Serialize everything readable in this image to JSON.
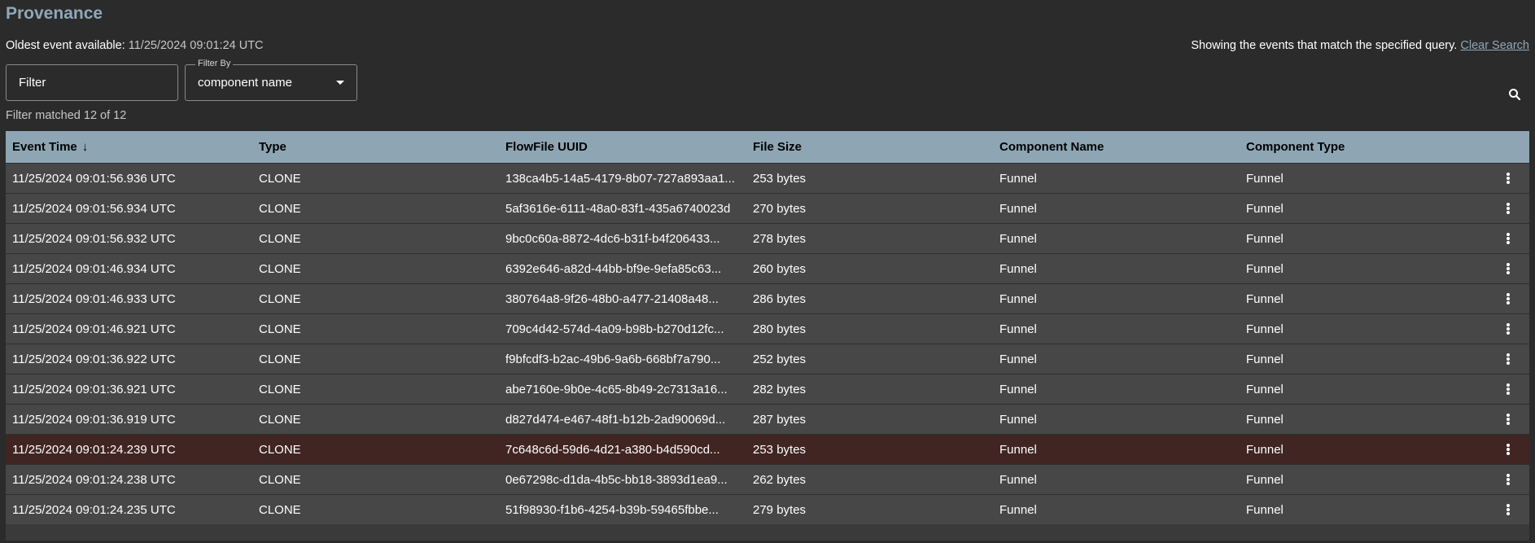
{
  "page_title": "Provenance",
  "oldest": {
    "label": "Oldest event available:",
    "value": "11/25/2024 09:01:24 UTC"
  },
  "query_status": {
    "text": "Showing the events that match the specified query.",
    "clear_label": "Clear Search"
  },
  "filter": {
    "placeholder": "Filter",
    "filter_by_label": "Filter By",
    "filter_by_value": "component name"
  },
  "matched_text": "Filter matched 12 of 12",
  "table": {
    "headers": [
      "Event Time",
      "Type",
      "FlowFile UUID",
      "File Size",
      "Component Name",
      "Component Type"
    ],
    "sort_indicator": "↓",
    "rows": [
      {
        "time": "11/25/2024 09:01:56.936 UTC",
        "type": "CLONE",
        "uuid": "138ca4b5-14a5-4179-8b07-727a893aa1...",
        "size": "253 bytes",
        "name": "Funnel",
        "ctype": "Funnel"
      },
      {
        "time": "11/25/2024 09:01:56.934 UTC",
        "type": "CLONE",
        "uuid": "5af3616e-6111-48a0-83f1-435a6740023d",
        "size": "270 bytes",
        "name": "Funnel",
        "ctype": "Funnel"
      },
      {
        "time": "11/25/2024 09:01:56.932 UTC",
        "type": "CLONE",
        "uuid": "9bc0c60a-8872-4dc6-b31f-b4f206433...",
        "size": "278 bytes",
        "name": "Funnel",
        "ctype": "Funnel"
      },
      {
        "time": "11/25/2024 09:01:46.934 UTC",
        "type": "CLONE",
        "uuid": "6392e646-a82d-44bb-bf9e-9efa85c63...",
        "size": "260 bytes",
        "name": "Funnel",
        "ctype": "Funnel"
      },
      {
        "time": "11/25/2024 09:01:46.933 UTC",
        "type": "CLONE",
        "uuid": "380764a8-9f26-48b0-a477-21408a48...",
        "size": "286 bytes",
        "name": "Funnel",
        "ctype": "Funnel"
      },
      {
        "time": "11/25/2024 09:01:46.921 UTC",
        "type": "CLONE",
        "uuid": "709c4d42-574d-4a09-b98b-b270d12fc...",
        "size": "280 bytes",
        "name": "Funnel",
        "ctype": "Funnel"
      },
      {
        "time": "11/25/2024 09:01:36.922 UTC",
        "type": "CLONE",
        "uuid": "f9bfcdf3-b2ac-49b6-9a6b-668bf7a790...",
        "size": "252 bytes",
        "name": "Funnel",
        "ctype": "Funnel"
      },
      {
        "time": "11/25/2024 09:01:36.921 UTC",
        "type": "CLONE",
        "uuid": "abe7160e-9b0e-4c65-8b49-2c7313a16...",
        "size": "282 bytes",
        "name": "Funnel",
        "ctype": "Funnel"
      },
      {
        "time": "11/25/2024 09:01:36.919 UTC",
        "type": "CLONE",
        "uuid": "d827d474-e467-48f1-b12b-2ad90069d...",
        "size": "287 bytes",
        "name": "Funnel",
        "ctype": "Funnel"
      },
      {
        "time": "11/25/2024 09:01:24.239 UTC",
        "type": "CLONE",
        "uuid": "7c648c6d-59d6-4d21-a380-b4d590cd...",
        "size": "253 bytes",
        "name": "Funnel",
        "ctype": "Funnel",
        "selected": true
      },
      {
        "time": "11/25/2024 09:01:24.238 UTC",
        "type": "CLONE",
        "uuid": "0e67298c-d1da-4b5c-bb18-3893d1ea9...",
        "size": "262 bytes",
        "name": "Funnel",
        "ctype": "Funnel"
      },
      {
        "time": "11/25/2024 09:01:24.235 UTC",
        "type": "CLONE",
        "uuid": "51f98930-f1b6-4254-b39b-59465fbbe...",
        "size": "279 bytes",
        "name": "Funnel",
        "ctype": "Funnel"
      }
    ]
  },
  "icons": {
    "search": "search-icon",
    "row_menu": "more-vertical-icon",
    "sort": "arrow-down-icon"
  },
  "colors": {
    "background": "#2b2b2b",
    "accent": "#8fa8b8",
    "header_bg": "#8ea6b4",
    "row_bg": "#474747",
    "selected_row_bg": "#402522"
  }
}
